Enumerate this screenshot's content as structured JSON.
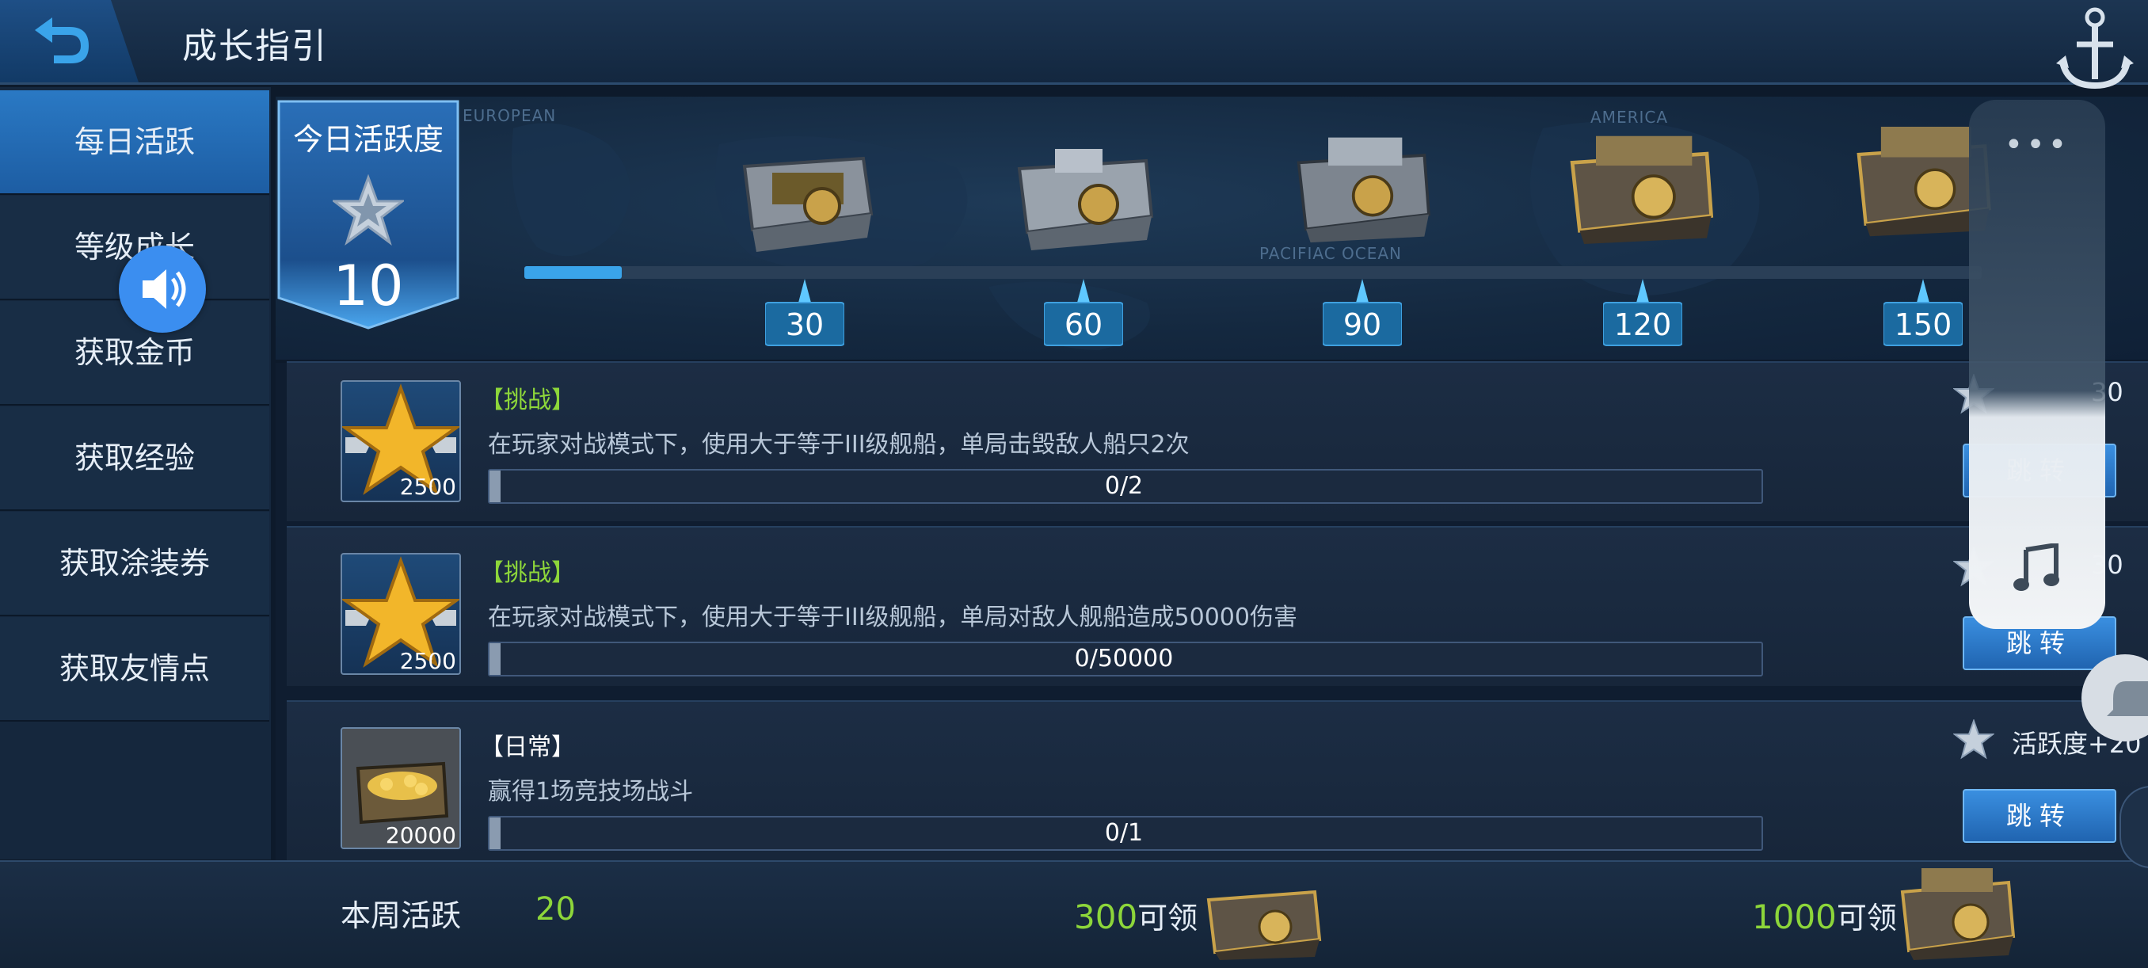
{
  "header": {
    "title": "成长指引",
    "back_icon": "back-arrow-icon",
    "emblem_icon": "anchor-icon"
  },
  "sidebar": {
    "items": [
      {
        "label": "每日活跃",
        "active": true
      },
      {
        "label": "等级成长",
        "active": false
      },
      {
        "label": "获取金币",
        "active": false
      },
      {
        "label": "获取经验",
        "active": false
      },
      {
        "label": "获取涂装券",
        "active": false
      },
      {
        "label": "获取友情点",
        "active": false
      }
    ]
  },
  "activity": {
    "today_label": "今日活跃度",
    "today_value": "10",
    "progress_fraction": 0.0667,
    "map_labels": [
      "EUROPEAN",
      "AMERICA",
      "PACIFIAC OCEAN"
    ],
    "milestones": [
      "30",
      "60",
      "90",
      "120",
      "150"
    ]
  },
  "tasks": [
    {
      "tag": "【挑战】",
      "tag_color": "#8dd63a",
      "desc": "在玩家对战模式下，使用大于等于III级舰船，单局击毁敌人船只2次",
      "reward_amount": "2500",
      "reward_icon": "gold-star-icon",
      "progress": "0/2",
      "points": "30",
      "button": "跳转"
    },
    {
      "tag": "【挑战】",
      "tag_color": "#8dd63a",
      "desc": "在玩家对战模式下，使用大于等于III级舰船，单局对敌人舰船造成50000伤害",
      "reward_amount": "2500",
      "reward_icon": "gold-star-icon",
      "progress": "0/50000",
      "points": "30",
      "button": "跳转"
    },
    {
      "tag": "【日常】",
      "tag_color": "#ffffff",
      "desc": "赢得1场竞技场战斗",
      "reward_amount": "20000",
      "reward_icon": "gold-chest-icon",
      "progress": "0/1",
      "points": "活跃度+20",
      "button": "跳转"
    }
  ],
  "footer": {
    "week_label": "本周活跃",
    "week_value": "20",
    "claim1_num": "300",
    "claim1_text": "可领",
    "claim2_num": "1000",
    "claim2_text": "可领"
  },
  "overlay": {
    "dots": "•••",
    "music_icon": "music-note-icon",
    "speaker_icon": "speaker-icon",
    "bell_icon": "bell-icon"
  }
}
